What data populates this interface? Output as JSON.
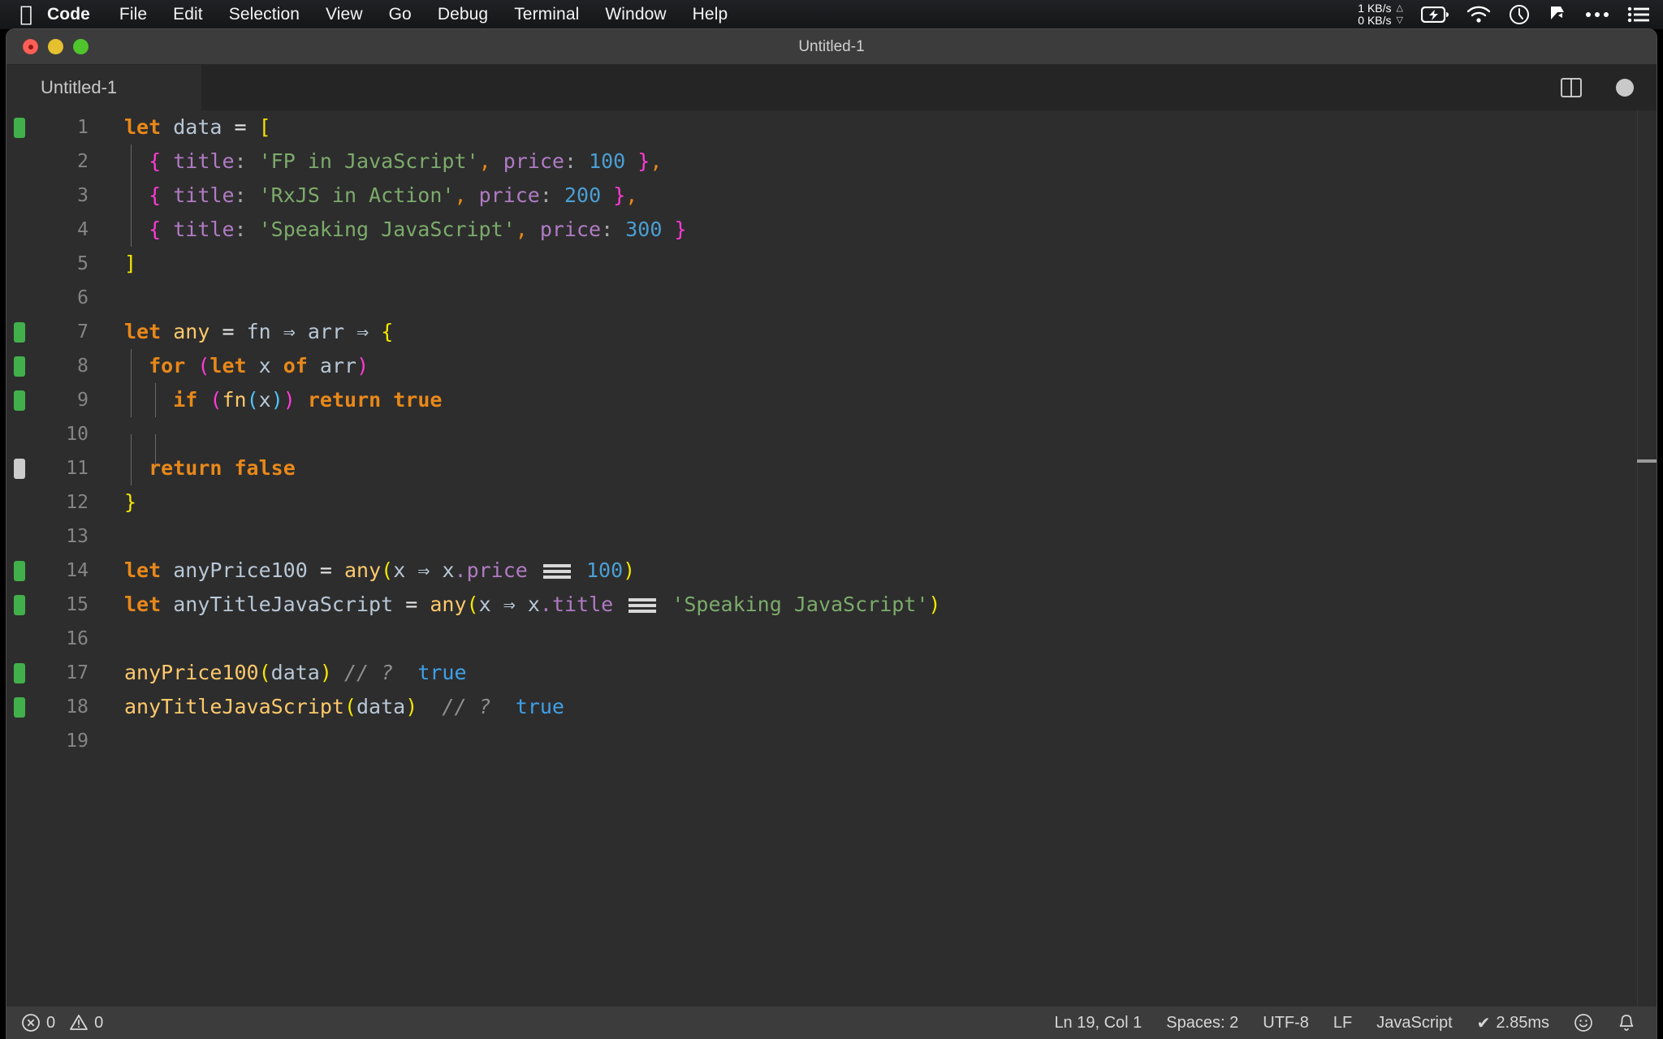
{
  "menubar": {
    "apple_icon": "apple-logo-icon",
    "items": [
      {
        "label": "Code",
        "bold": true
      },
      {
        "label": "File"
      },
      {
        "label": "Edit"
      },
      {
        "label": "Selection"
      },
      {
        "label": "View"
      },
      {
        "label": "Go"
      },
      {
        "label": "Debug"
      },
      {
        "label": "Terminal"
      },
      {
        "label": "Window"
      },
      {
        "label": "Help"
      }
    ],
    "status": {
      "net_up": "1 KB/s",
      "net_down": "0 KB/s",
      "arrow_up": "△",
      "arrow_down": "▽",
      "icons": [
        "battery-charging-icon",
        "wifi-icon",
        "clock-icon",
        "dropbox-icon",
        "ellipsis-icon",
        "control-center-icon"
      ]
    }
  },
  "window": {
    "title": "Untitled-1",
    "traffic_lights": [
      "close-button",
      "minimize-button",
      "maximize-button"
    ]
  },
  "tabbar": {
    "tabs": [
      {
        "label": "Untitled-1",
        "active": true
      }
    ],
    "split_editor_label": "split-editor-icon",
    "dirty_indicator": "unsaved-changes-dot"
  },
  "editor": {
    "language": "JavaScript",
    "lines": [
      {
        "n": "1",
        "mark": "added",
        "guides": [],
        "tokens": [
          {
            "t": "let",
            "c": "kw"
          },
          {
            "t": " ",
            "c": "op"
          },
          {
            "t": "data",
            "c": "ident"
          },
          {
            "t": " ",
            "c": "op"
          },
          {
            "t": "=",
            "c": "op"
          },
          {
            "t": " ",
            "c": "op"
          },
          {
            "t": "[",
            "c": "brkY"
          }
        ]
      },
      {
        "n": "2",
        "mark": "none",
        "guides": [
          0
        ],
        "tokens": [
          {
            "t": "  ",
            "c": "op"
          },
          {
            "t": "{",
            "c": "brkP"
          },
          {
            "t": " ",
            "c": "op"
          },
          {
            "t": "title",
            "c": "prop"
          },
          {
            "t": ":",
            "c": "punc"
          },
          {
            "t": " ",
            "c": "op"
          },
          {
            "t": "'FP in JavaScript'",
            "c": "str"
          },
          {
            "t": ",",
            "c": "comma"
          },
          {
            "t": " ",
            "c": "op"
          },
          {
            "t": "price",
            "c": "prop"
          },
          {
            "t": ":",
            "c": "punc"
          },
          {
            "t": " ",
            "c": "op"
          },
          {
            "t": "100",
            "c": "num"
          },
          {
            "t": " ",
            "c": "op"
          },
          {
            "t": "}",
            "c": "brkP"
          },
          {
            "t": ",",
            "c": "comma"
          }
        ]
      },
      {
        "n": "3",
        "mark": "none",
        "guides": [
          0
        ],
        "tokens": [
          {
            "t": "  ",
            "c": "op"
          },
          {
            "t": "{",
            "c": "brkP"
          },
          {
            "t": " ",
            "c": "op"
          },
          {
            "t": "title",
            "c": "prop"
          },
          {
            "t": ":",
            "c": "punc"
          },
          {
            "t": " ",
            "c": "op"
          },
          {
            "t": "'RxJS in Action'",
            "c": "str"
          },
          {
            "t": ",",
            "c": "comma"
          },
          {
            "t": " ",
            "c": "op"
          },
          {
            "t": "price",
            "c": "prop"
          },
          {
            "t": ":",
            "c": "punc"
          },
          {
            "t": " ",
            "c": "op"
          },
          {
            "t": "200",
            "c": "num"
          },
          {
            "t": " ",
            "c": "op"
          },
          {
            "t": "}",
            "c": "brkP"
          },
          {
            "t": ",",
            "c": "comma"
          }
        ]
      },
      {
        "n": "4",
        "mark": "none",
        "guides": [
          0
        ],
        "tokens": [
          {
            "t": "  ",
            "c": "op"
          },
          {
            "t": "{",
            "c": "brkP"
          },
          {
            "t": " ",
            "c": "op"
          },
          {
            "t": "title",
            "c": "prop"
          },
          {
            "t": ":",
            "c": "punc"
          },
          {
            "t": " ",
            "c": "op"
          },
          {
            "t": "'Speaking JavaScript'",
            "c": "str"
          },
          {
            "t": ",",
            "c": "comma"
          },
          {
            "t": " ",
            "c": "op"
          },
          {
            "t": "price",
            "c": "prop"
          },
          {
            "t": ":",
            "c": "punc"
          },
          {
            "t": " ",
            "c": "op"
          },
          {
            "t": "300",
            "c": "num"
          },
          {
            "t": " ",
            "c": "op"
          },
          {
            "t": "}",
            "c": "brkP"
          }
        ]
      },
      {
        "n": "5",
        "mark": "none",
        "guides": [],
        "tokens": [
          {
            "t": "]",
            "c": "brkY"
          }
        ]
      },
      {
        "n": "6",
        "mark": "none",
        "guides": [],
        "tokens": []
      },
      {
        "n": "7",
        "mark": "added",
        "guides": [],
        "tokens": [
          {
            "t": "let",
            "c": "kw"
          },
          {
            "t": " ",
            "c": "op"
          },
          {
            "t": "any",
            "c": "fname"
          },
          {
            "t": " ",
            "c": "op"
          },
          {
            "t": "=",
            "c": "op"
          },
          {
            "t": " ",
            "c": "op"
          },
          {
            "t": "fn",
            "c": "ident"
          },
          {
            "t": " ",
            "c": "op"
          },
          {
            "t": "⇒",
            "c": "arrow"
          },
          {
            "t": " ",
            "c": "op"
          },
          {
            "t": "arr",
            "c": "ident"
          },
          {
            "t": " ",
            "c": "op"
          },
          {
            "t": "⇒",
            "c": "arrow"
          },
          {
            "t": " ",
            "c": "op"
          },
          {
            "t": "{",
            "c": "brkY"
          }
        ]
      },
      {
        "n": "8",
        "mark": "added",
        "guides": [
          0
        ],
        "tokens": [
          {
            "t": "  ",
            "c": "op"
          },
          {
            "t": "for",
            "c": "kw"
          },
          {
            "t": " ",
            "c": "op"
          },
          {
            "t": "(",
            "c": "brkP"
          },
          {
            "t": "let",
            "c": "kw"
          },
          {
            "t": " ",
            "c": "op"
          },
          {
            "t": "x",
            "c": "ident"
          },
          {
            "t": " ",
            "c": "op"
          },
          {
            "t": "of",
            "c": "kw"
          },
          {
            "t": " ",
            "c": "op"
          },
          {
            "t": "arr",
            "c": "ident"
          },
          {
            "t": ")",
            "c": "brkP"
          }
        ]
      },
      {
        "n": "9",
        "mark": "added",
        "guides": [
          0,
          1
        ],
        "tokens": [
          {
            "t": "    ",
            "c": "op"
          },
          {
            "t": "if",
            "c": "kw"
          },
          {
            "t": " ",
            "c": "op"
          },
          {
            "t": "(",
            "c": "brkP"
          },
          {
            "t": "fn",
            "c": "fname"
          },
          {
            "t": "(",
            "c": "brkB"
          },
          {
            "t": "x",
            "c": "ident"
          },
          {
            "t": ")",
            "c": "brkB"
          },
          {
            "t": ")",
            "c": "brkP"
          },
          {
            "t": " ",
            "c": "op"
          },
          {
            "t": "return",
            "c": "kw"
          },
          {
            "t": " ",
            "c": "op"
          },
          {
            "t": "true",
            "c": "kw"
          }
        ]
      },
      {
        "n": "10",
        "mark": "none",
        "guides": [
          0,
          1
        ],
        "tokens": []
      },
      {
        "n": "11",
        "mark": "modified",
        "guides": [
          0
        ],
        "tokens": [
          {
            "t": "  ",
            "c": "op"
          },
          {
            "t": "return",
            "c": "kw"
          },
          {
            "t": " ",
            "c": "op"
          },
          {
            "t": "false",
            "c": "kw"
          }
        ]
      },
      {
        "n": "12",
        "mark": "none",
        "guides": [],
        "tokens": [
          {
            "t": "}",
            "c": "brkY"
          }
        ]
      },
      {
        "n": "13",
        "mark": "none",
        "guides": [],
        "tokens": []
      },
      {
        "n": "14",
        "mark": "added",
        "guides": [],
        "tokens": [
          {
            "t": "let",
            "c": "kw"
          },
          {
            "t": " ",
            "c": "op"
          },
          {
            "t": "anyPrice100",
            "c": "ident"
          },
          {
            "t": " ",
            "c": "op"
          },
          {
            "t": "=",
            "c": "op"
          },
          {
            "t": " ",
            "c": "op"
          },
          {
            "t": "any",
            "c": "fname"
          },
          {
            "t": "(",
            "c": "brkY"
          },
          {
            "t": "x",
            "c": "ident"
          },
          {
            "t": " ",
            "c": "op"
          },
          {
            "t": "⇒",
            "c": "arrow"
          },
          {
            "t": " ",
            "c": "op"
          },
          {
            "t": "x",
            "c": "ident"
          },
          {
            "t": ".",
            "c": "prop"
          },
          {
            "t": "price",
            "c": "prop"
          },
          {
            "t": " ",
            "c": "op"
          },
          {
            "t": "===",
            "c": "eqq"
          },
          {
            "t": " ",
            "c": "op"
          },
          {
            "t": "100",
            "c": "num"
          },
          {
            "t": ")",
            "c": "brkY"
          }
        ]
      },
      {
        "n": "15",
        "mark": "added",
        "guides": [],
        "tokens": [
          {
            "t": "let",
            "c": "kw"
          },
          {
            "t": " ",
            "c": "op"
          },
          {
            "t": "anyTitleJavaScript",
            "c": "ident"
          },
          {
            "t": " ",
            "c": "op"
          },
          {
            "t": "=",
            "c": "op"
          },
          {
            "t": " ",
            "c": "op"
          },
          {
            "t": "any",
            "c": "fname"
          },
          {
            "t": "(",
            "c": "brkY"
          },
          {
            "t": "x",
            "c": "ident"
          },
          {
            "t": " ",
            "c": "op"
          },
          {
            "t": "⇒",
            "c": "arrow"
          },
          {
            "t": " ",
            "c": "op"
          },
          {
            "t": "x",
            "c": "ident"
          },
          {
            "t": ".",
            "c": "prop"
          },
          {
            "t": "title",
            "c": "prop"
          },
          {
            "t": " ",
            "c": "op"
          },
          {
            "t": "===",
            "c": "eqq"
          },
          {
            "t": " ",
            "c": "op"
          },
          {
            "t": "'Speaking JavaScript'",
            "c": "str"
          },
          {
            "t": ")",
            "c": "brkY"
          }
        ]
      },
      {
        "n": "16",
        "mark": "none",
        "guides": [],
        "tokens": []
      },
      {
        "n": "17",
        "mark": "added",
        "guides": [],
        "tokens": [
          {
            "t": "anyPrice100",
            "c": "fname"
          },
          {
            "t": "(",
            "c": "brkY"
          },
          {
            "t": "data",
            "c": "ident"
          },
          {
            "t": ")",
            "c": "brkY"
          },
          {
            "t": " ",
            "c": "op"
          },
          {
            "t": "// ?",
            "c": "cmt"
          },
          {
            "t": "  ",
            "c": "op"
          },
          {
            "t": "true",
            "c": "bool"
          }
        ]
      },
      {
        "n": "18",
        "mark": "added",
        "guides": [],
        "tokens": [
          {
            "t": "anyTitleJavaScript",
            "c": "fname"
          },
          {
            "t": "(",
            "c": "brkY"
          },
          {
            "t": "data",
            "c": "ident"
          },
          {
            "t": ")",
            "c": "brkY"
          },
          {
            "t": "  ",
            "c": "op"
          },
          {
            "t": "// ?",
            "c": "cmt"
          },
          {
            "t": "  ",
            "c": "op"
          },
          {
            "t": "true",
            "c": "bool"
          }
        ]
      },
      {
        "n": "19",
        "mark": "none",
        "guides": [],
        "tokens": []
      }
    ]
  },
  "statusbar": {
    "errors_label": "0",
    "warnings_label": "0",
    "error_icon": "error-circle-icon",
    "warning_icon": "warning-triangle-icon",
    "cursor_position": "Ln 19, Col 1",
    "indentation": "Spaces: 2",
    "encoding": "UTF-8",
    "eol": "LF",
    "language_mode": "JavaScript",
    "quokka_check": "✔",
    "quokka_time": "2.85ms",
    "feedback_icon": "smiley-icon",
    "notifications_icon": "bell-icon"
  },
  "colors": {
    "menubar_bg": "#1a1c1e",
    "titlebar_bg": "#3c3c3c",
    "editor_bg": "#2d2d2d",
    "tabbar_bg": "#252526",
    "statusbar_bg": "#3c3c3c",
    "gutter_added": "#41b04b",
    "gutter_modified": "#cccccc",
    "keyword": "#e8881a",
    "string": "#7cab6b",
    "number": "#4a9fd4",
    "function": "#fdc96b",
    "property": "#b07bc4",
    "bracket_yellow": "#f3e600",
    "bracket_pink": "#ff3ad6",
    "bracket_blue": "#4fc3f7",
    "comment": "#8f8f8f",
    "identifier": "#b8c7d6"
  }
}
